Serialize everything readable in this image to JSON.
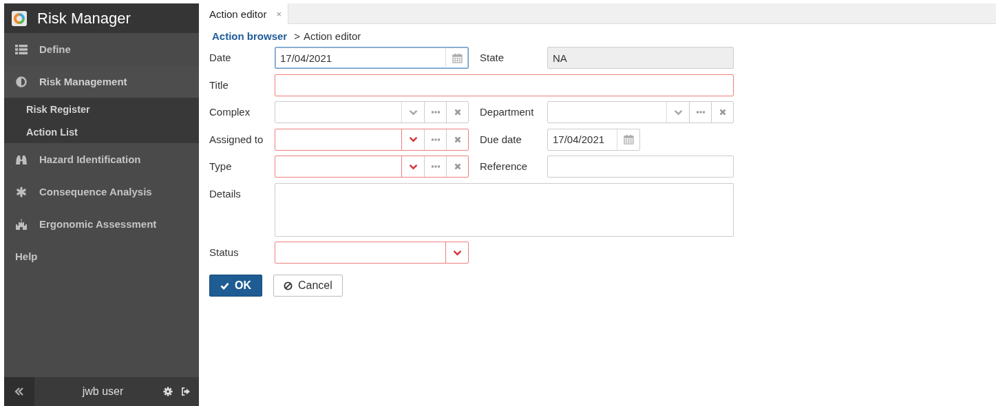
{
  "app": {
    "title": "Risk Manager"
  },
  "sidebar": {
    "items": [
      {
        "label": "Define"
      },
      {
        "label": "Risk Management",
        "expanded": true,
        "children": [
          {
            "label": "Risk Register"
          },
          {
            "label": "Action List"
          }
        ]
      },
      {
        "label": "Hazard Identification"
      },
      {
        "label": "Consequence Analysis"
      },
      {
        "label": "Ergonomic Assessment"
      },
      {
        "label": "Help"
      }
    ],
    "footer": {
      "user": "jwb user"
    }
  },
  "tabs": [
    {
      "label": "Action editor",
      "close": "×",
      "selected": true
    }
  ],
  "breadcrumb": {
    "link": "Action browser",
    "separator": ">",
    "current": "Action editor"
  },
  "form": {
    "rows": [
      {
        "fields": [
          {
            "label": "Date",
            "kind": "date",
            "value": "17/04/2021",
            "required": false,
            "focused": true,
            "disabled": false
          },
          {
            "label": "State",
            "kind": "text",
            "value": "NA",
            "required": false,
            "focused": false,
            "disabled": true
          }
        ]
      },
      {
        "fields": [
          {
            "label": "Title",
            "kind": "text",
            "required": true,
            "focused": false,
            "disabled": false
          }
        ]
      },
      {
        "fields": [
          {
            "label": "Complex",
            "kind": "combo",
            "required": false,
            "focused": false,
            "disabled": false
          },
          {
            "label": "Department",
            "kind": "combo",
            "required": false,
            "focused": false,
            "disabled": false
          }
        ]
      },
      {
        "fields": [
          {
            "label": "Assigned to",
            "kind": "combo",
            "required": true,
            "focused": false,
            "disabled": false
          },
          {
            "label": "Due date",
            "kind": "date",
            "value": "17/04/2021",
            "required": false,
            "focused": false,
            "disabled": false
          }
        ]
      },
      {
        "fields": [
          {
            "label": "Type",
            "kind": "combo",
            "required": true,
            "focused": false,
            "disabled": false
          },
          {
            "label": "Reference",
            "kind": "text",
            "required": false,
            "focused": false,
            "disabled": false
          }
        ]
      },
      {
        "fields": [
          {
            "label": "Details",
            "kind": "textarea",
            "required": false,
            "focused": false,
            "disabled": false
          }
        ]
      },
      {
        "fields": [
          {
            "label": "Status",
            "kind": "select",
            "required": true,
            "focused": false,
            "disabled": false
          }
        ]
      }
    ]
  },
  "buttons": [
    {
      "label": "OK",
      "kind": "primary"
    },
    {
      "label": "Cancel",
      "kind": "secondary"
    }
  ]
}
